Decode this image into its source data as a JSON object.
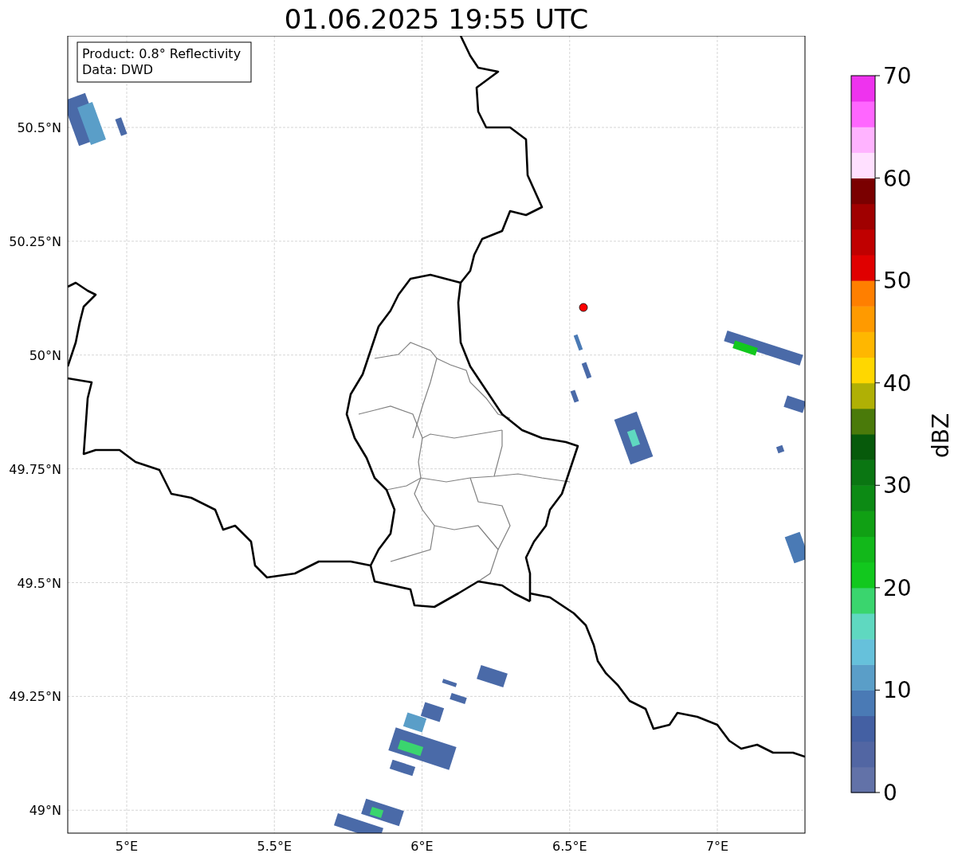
{
  "title": "01.06.2025 19:55 UTC",
  "info_box": [
    "Product: 0.8° Reflectivity",
    "Data: DWD"
  ],
  "map": {
    "x_ticks": [
      "5°E",
      "5.5°E",
      "6°E",
      "6.5°E",
      "7°E"
    ],
    "y_ticks": [
      "50.5°N",
      "50.25°N",
      "50°N",
      "49.75°N",
      "49.5°N",
      "49.25°N",
      "49°N"
    ]
  },
  "colorbar": {
    "label": "dBZ",
    "ticks": [
      "70",
      "60",
      "50",
      "40",
      "30",
      "20",
      "10",
      "0"
    ],
    "segments": [
      {
        "color": "#6272a8"
      },
      {
        "color": "#5266a3"
      },
      {
        "color": "#4460a3"
      },
      {
        "color": "#4a7ab5"
      },
      {
        "color": "#5a9ec8"
      },
      {
        "color": "#66c1db"
      },
      {
        "color": "#5fd8c0"
      },
      {
        "color": "#3ad56e"
      },
      {
        "color": "#12c81e"
      },
      {
        "color": "#12b81a"
      },
      {
        "color": "#10a014"
      },
      {
        "color": "#0c8a14"
      },
      {
        "color": "#0a7612"
      },
      {
        "color": "#075a0b"
      },
      {
        "color": "#4a7a0a"
      },
      {
        "color": "#b0b005"
      },
      {
        "color": "#ffd700"
      },
      {
        "color": "#ffb700"
      },
      {
        "color": "#ff9a00"
      },
      {
        "color": "#ff7f00"
      },
      {
        "color": "#e00000"
      },
      {
        "color": "#c00000"
      },
      {
        "color": "#a00000"
      },
      {
        "color": "#7a0000"
      },
      {
        "color": "#ffe0ff"
      },
      {
        "color": "#ffb3ff"
      },
      {
        "color": "#ff66ff"
      },
      {
        "color": "#ee33ee"
      }
    ]
  }
}
